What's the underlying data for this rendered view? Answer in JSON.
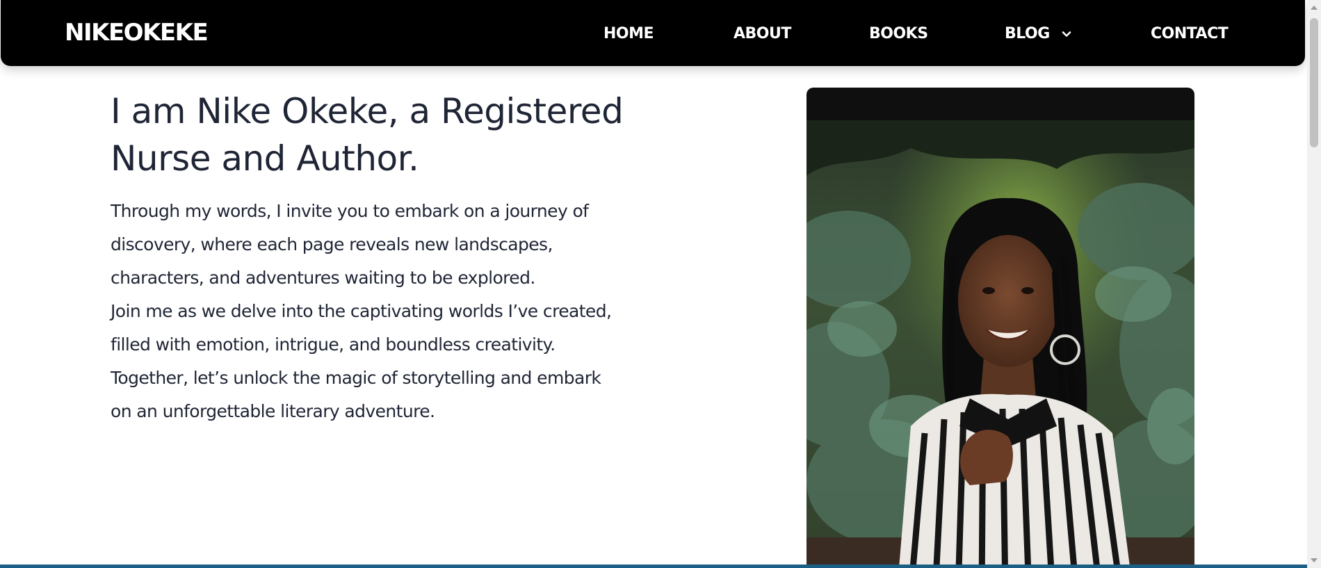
{
  "nav": {
    "brand": "NIKEOKEKE",
    "items": [
      {
        "label": "HOME"
      },
      {
        "label": "ABOUT"
      },
      {
        "label": "BOOKS"
      },
      {
        "label": "BLOG",
        "has_dropdown": true
      },
      {
        "label": "CONTACT"
      }
    ]
  },
  "hero": {
    "title": "I am Nike Okeke, a Registered Nurse and Author.",
    "paragraphs": [
      "Through my words, I invite you to embark on a journey of discovery, where each page reveals new landscapes, characters, and adventures waiting to be explored.",
      "Join me as we delve into the captivating worlds I’ve created, filled with emotion, intrigue, and boundless creativity.",
      "Together, let’s unlock the magic of storytelling and embark on an unforgettable literary adventure."
    ]
  },
  "icons": {
    "dropdown": "chevron-down-icon",
    "portrait": "portrait-photo"
  },
  "colors": {
    "navbar_bg": "#000000",
    "nav_text": "#ffffff",
    "heading_text": "#1f2535",
    "body_text": "#1f2535",
    "page_bg": "#ffffff",
    "photo_card_bg": "#0f0f10"
  }
}
